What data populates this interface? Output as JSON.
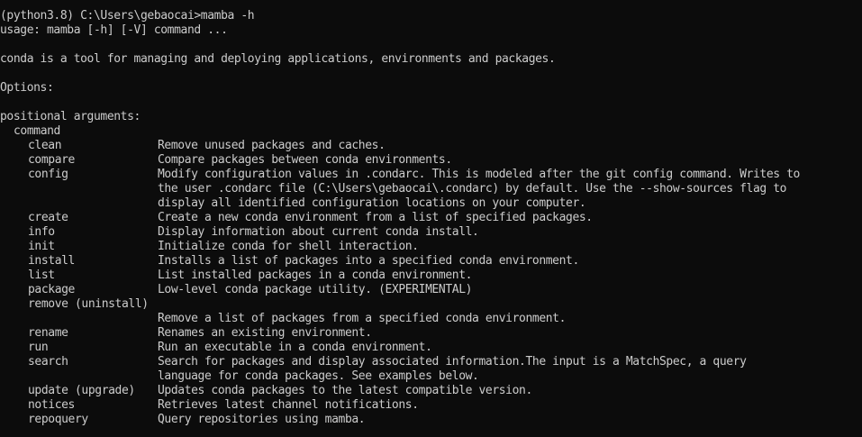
{
  "terminal": {
    "prompt": "(python3.8) C:\\Users\\gebaocai>mamba -h",
    "usage": "usage: mamba [-h] [-V] command ...",
    "blank1": "",
    "description": "conda is a tool for managing and deploying applications, environments and packages.",
    "blank2": "",
    "options_header": "Options:",
    "blank3": "",
    "positional_header": "positional arguments:",
    "command_label": "command",
    "commands": [
      {
        "name": "clean",
        "desc": "Remove unused packages and caches."
      },
      {
        "name": "compare",
        "desc": "Compare packages between conda environments."
      },
      {
        "name": "config",
        "desc": "Modify configuration values in .condarc. This is modeled after the git config command. Writes to"
      },
      {
        "name": "",
        "desc": "the user .condarc file (C:\\Users\\gebaocai\\.condarc) by default. Use the --show-sources flag to"
      },
      {
        "name": "",
        "desc": "display all identified configuration locations on your computer."
      },
      {
        "name": "create",
        "desc": "Create a new conda environment from a list of specified packages."
      },
      {
        "name": "info",
        "desc": "Display information about current conda install."
      },
      {
        "name": "init",
        "desc": "Initialize conda for shell interaction."
      },
      {
        "name": "install",
        "desc": "Installs a list of packages into a specified conda environment."
      },
      {
        "name": "list",
        "desc": "List installed packages in a conda environment."
      },
      {
        "name": "package",
        "desc": "Low-level conda package utility. (EXPERIMENTAL)"
      },
      {
        "name": "remove (uninstall)",
        "desc": ""
      },
      {
        "name": "",
        "desc": "Remove a list of packages from a specified conda environment."
      },
      {
        "name": "rename",
        "desc": "Renames an existing environment."
      },
      {
        "name": "run",
        "desc": "Run an executable in a conda environment."
      },
      {
        "name": "search",
        "desc": "Search for packages and display associated information.The input is a MatchSpec, a query"
      },
      {
        "name": "",
        "desc": "language for conda packages. See examples below."
      },
      {
        "name": "update (upgrade)",
        "desc": "Updates conda packages to the latest compatible version."
      },
      {
        "name": "notices",
        "desc": "Retrieves latest channel notifications."
      },
      {
        "name": "repoquery",
        "desc": "Query repositories using mamba."
      }
    ]
  },
  "colors": {
    "background": "#0c0c0c",
    "foreground": "#cccccc"
  }
}
